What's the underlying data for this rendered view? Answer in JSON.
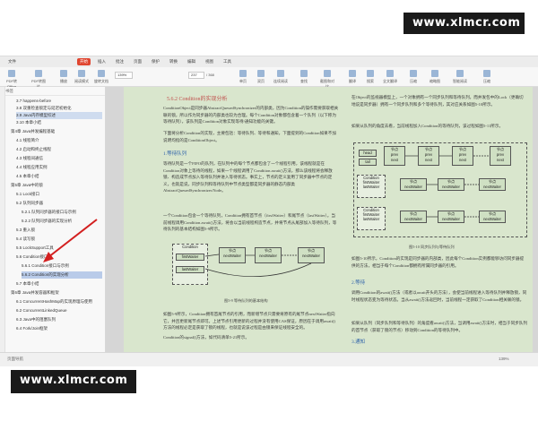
{
  "watermark": {
    "top": "www.xlmcr.com",
    "bottom": "www.xlmcr.com"
  },
  "app": {
    "tabs": [
      "文件",
      "开始",
      "插入",
      "批注",
      "页面",
      "保护",
      "转换",
      "编辑",
      "视图",
      "工具"
    ],
    "active_tab": "开始",
    "toolbar": {
      "buttons": [
        "PDF转Office",
        "PDF转图片",
        "播放",
        "阅读模式",
        "旋转文档",
        "单页",
        "双页",
        "连续阅读",
        "查找",
        "截图和对比",
        "翻译",
        "搜索",
        "全文翻译",
        "压缩",
        "缩略图",
        "智能阅读",
        "压缩"
      ],
      "zoom": "139%",
      "page_field": "237",
      "page_total": "/ 368"
    }
  },
  "sidebar": {
    "header": "书签",
    "items": [
      {
        "label": "3.7 happens-before"
      },
      {
        "label": "3.8 双重检查锁定与延迟初始化"
      },
      {
        "label": "3.9 Java内存模型综述"
      },
      {
        "label": "3.10 本章小结"
      },
      {
        "label": "第4章 Java并发编程基础"
      },
      {
        "label": "4.1 线程简介"
      },
      {
        "label": "4.2 启动和终止线程"
      },
      {
        "label": "4.3 线程间通信"
      },
      {
        "label": "4.4 线程应用实例"
      },
      {
        "label": "4.5 本章小结"
      },
      {
        "label": "第5章 Java中的锁"
      },
      {
        "label": "5.1 Lock接口"
      },
      {
        "label": "5.2 队列同步器"
      },
      {
        "label": "5.2.1 队列同步器的接口与示例"
      },
      {
        "label": "5.2.2 队列同步器的实现分析"
      },
      {
        "label": "5.3 重入锁"
      },
      {
        "label": "5.4 读写锁"
      },
      {
        "label": "5.5 LockSupport工具"
      },
      {
        "label": "5.6 Condition接口"
      },
      {
        "label": "5.6.1 Condition接口与示例"
      },
      {
        "label": "5.6.2 Condition的实现分析"
      },
      {
        "label": "5.7 本章小结"
      },
      {
        "label": "第6章 Java并发容器和框架"
      },
      {
        "label": "6.1 ConcurrentHashMap的实现原理与使用"
      },
      {
        "label": "6.2 ConcurrentLinkedQueue"
      },
      {
        "label": "6.3 Java中的阻塞队列"
      },
      {
        "label": "6.4 Fork/Join框架"
      }
    ]
  },
  "doc": {
    "heading": "5.6.2 Condition的实现分析",
    "para1": "ConditionObject是同步器AbstractQueuedSynchronizer的内部类，因为Condition的操作需要获取相关联的锁，所以作为同步器的内部类也较为合理。每个Condition对象都包含着一个队列（以下称为等待队列），该队列是Condition对象实现等待/通知功能的关键。",
    "para2": "下面将分析Condition的实现，主要包括：等待队列、等待和通知，下面提到的Condition如果不加说明均指的是ConditionObject。",
    "sub1": "1.等待队列",
    "para3": "等待队列是一个FIFO的队列，在队列中的每个节点都包含了一个线程引用，该线程就是在Condition对象上等待的线程，如果一个线程调用了Condition.await()方法，那么该线程将会释放锁、构造成节点加入等待队列并进入等待状态。事实上，节点的定义复用了同步器中节点的定义，也就是说，同步队列和等待队列中节点类型都是同步器的静态内部类AbstractQueuedSynchronizer.Node。",
    "para4": "一个Condition包含一个等待队列，Condition拥有首节点（firstWaiter）和尾节点（lastWaiter）。当前线程调用Condition.await()方法，将会以当前线程构造节点，并将节点从尾部加入等待队列，等待队列的基本结构如图5-9所示。",
    "fig1_caption": "图5-9 等待队列的基本结构",
    "para5": "如图5-9所示，Condition拥有首尾节点的引用，而新增节点只需要将原有的尾节点nextWaiter指向它，并且更新尾节点即可。上述节点引用更新的过程并没有使用CAS保证，原因在于调用await()方法的线程必定是获取了锁的线程，也就是说该过程是由锁来保证线程安全的。",
    "para6": "在Object的监视器模型上，一个对象拥有一个同步队列和等待队列，而并发包中的Lock（更确切地说是同步器）拥有一个同步队列和多个等待队列，其对应关系如图5-10所示。",
    "fig2_caption": "图5-10 同步队列与等待队列",
    "para7": "如图5-10所示，Condition的实现是同步器的内部类，因此每个Condition实例都能够访问同步器提供的方法，相当于每个Condition都拥有所属同步器的引用。",
    "sub2": "2.等待",
    "para8": "调用Condition的await()方法（或者以await开头的方法），会使当前线程进入等待队列并释放锁，同时线程状态变为等待状态。当从await()方法返回时，当前线程一定获取了Condition相关联的锁。",
    "para9": "如果从队列（同步队列和等待队列）的角度看await()方法，当调用await()方法时，相当于同步队列的首节点（获取了锁的节点）移动到Condition的等待队列中。",
    "para10": "如果从队列的角度去看，当前线程加入Condition的等待队列，该过程如图5-11所示。",
    "para11": "Condition的signal()方法，如代码清单5-21所示。",
    "sub3": "3.通知"
  },
  "diagram1": {
    "condition": "Condition",
    "first": "firstWaiter",
    "last": "lastWaiter",
    "node": "节点",
    "next": "nextWaiter"
  },
  "diagram2": {
    "head": "head",
    "tail": "tail",
    "node": "节点",
    "prev": "prev",
    "next": "next",
    "condition": "Condition",
    "first": "firstWaiter",
    "last": "lastWaiter",
    "nextw": "nextWaiter",
    "lock": "Lock（同步器）",
    "wait": "等待队列",
    "sync": "同步队列"
  },
  "status": {
    "left": "页面导航",
    "zoom": "139%"
  }
}
